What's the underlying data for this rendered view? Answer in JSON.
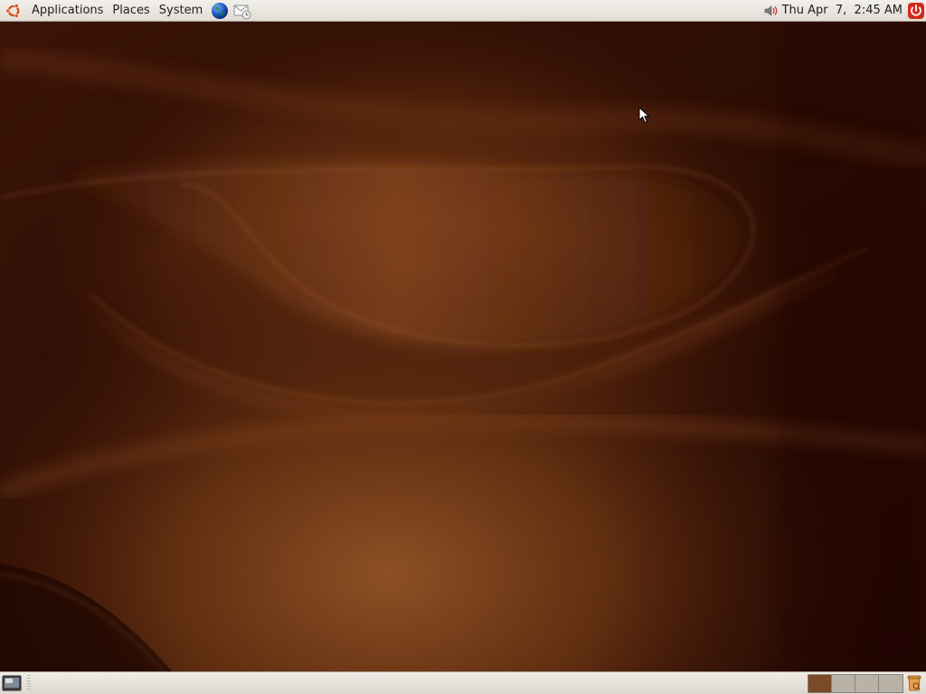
{
  "top_panel": {
    "menus": [
      "Applications",
      "Places",
      "System"
    ],
    "launchers": [
      "web-browser-icon",
      "email-client-icon"
    ],
    "clock": "Thu Apr  7,  2:45 AM",
    "tray_icons": [
      "volume-icon",
      "power-icon"
    ]
  },
  "bottom_panel": {
    "show_desktop_icon": "show-desktop-icon",
    "workspace_count": 4,
    "active_workspace": 1,
    "trash_icon": "trash-icon"
  },
  "colors": {
    "panel": "#e6e2da",
    "accent": "#dd4814",
    "wallpaper_dark": "#2a0d04",
    "wallpaper_light": "#8a4e22",
    "active_workspace": "#7b4a28"
  }
}
